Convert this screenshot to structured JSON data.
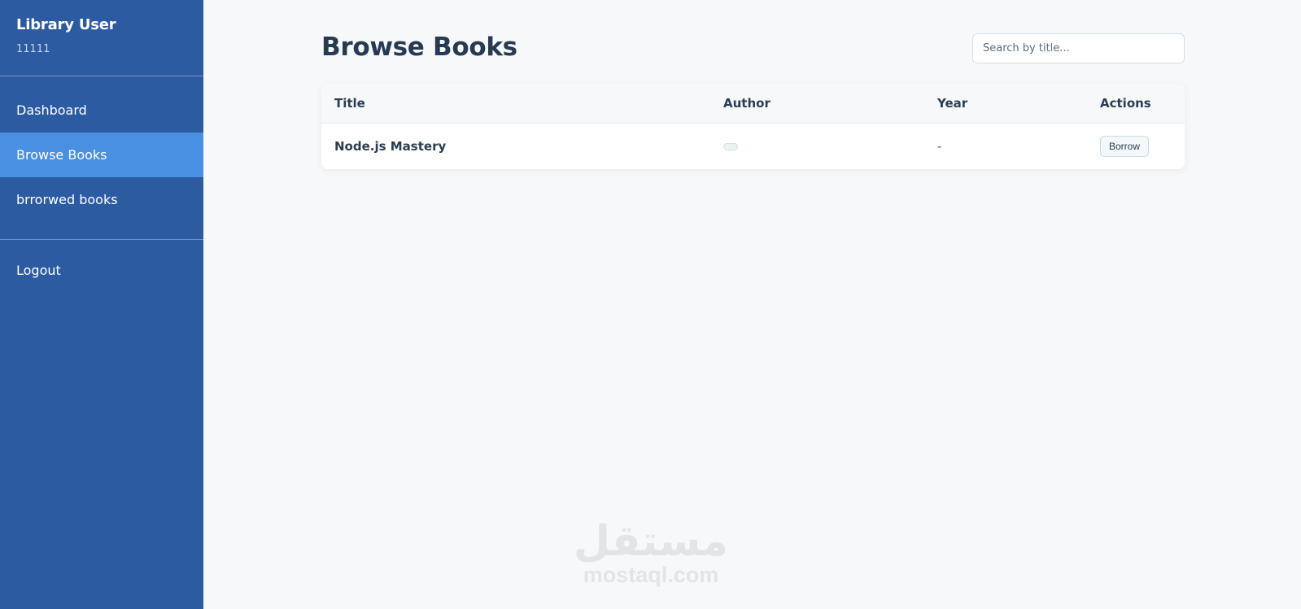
{
  "sidebar": {
    "user_name": "Library User",
    "user_id": "11111",
    "items": [
      {
        "label": "Dashboard"
      },
      {
        "label": "Browse Books"
      },
      {
        "label": "brrorwed books"
      }
    ],
    "logout_label": "Logout"
  },
  "main": {
    "title": "Browse Books",
    "search": {
      "placeholder": "Search by title...",
      "value": ""
    },
    "table": {
      "headers": [
        "Title",
        "Author",
        "Year",
        "Actions"
      ],
      "rows": [
        {
          "title": "Node.js Mastery",
          "year": "-",
          "action_label": "Borrow"
        }
      ]
    }
  },
  "watermark": {
    "arabic": "مستقل",
    "latin": "mostaql.com"
  },
  "colors": {
    "sidebar_bg": "#2c5ba2",
    "sidebar_active": "#4a90e2",
    "page_bg": "#f6f8f9",
    "text_dark": "#263a52"
  }
}
